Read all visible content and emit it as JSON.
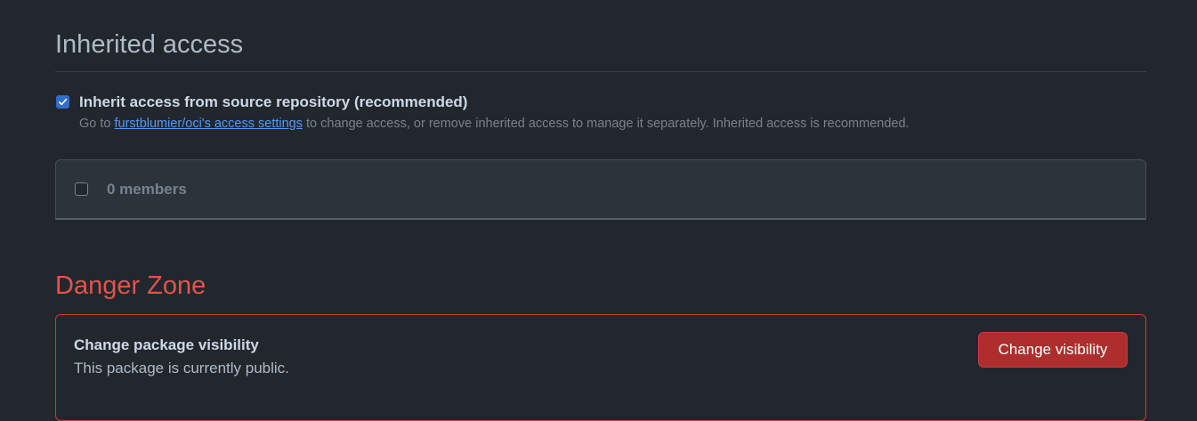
{
  "inherited_access": {
    "title": "Inherited access",
    "checkbox_label": "Inherit access from source repository (recommended)",
    "checked": true,
    "note_prefix": "Go to ",
    "note_link": "furstblumier/oci's access settings",
    "note_suffix": " to change access, or remove inherited access to manage it separately. Inherited access is recommended."
  },
  "members": {
    "count_label": "0 members"
  },
  "danger_zone": {
    "title": "Danger Zone",
    "item_title": "Change package visibility",
    "item_description": "This package is currently public.",
    "button_label": "Change visibility"
  },
  "colors": {
    "background": "#22272e",
    "accent_blue": "#316dca",
    "link": "#539bf5",
    "danger": "#e5534b",
    "danger_button": "#ad2e2c"
  }
}
